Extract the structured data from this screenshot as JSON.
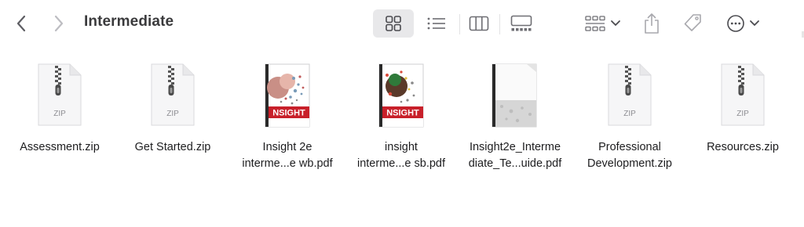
{
  "window": {
    "title": "Intermediate"
  },
  "toolbar": {
    "back": "back-chevron",
    "forward": "forward-chevron",
    "view_modes": [
      "icon-view",
      "list-view",
      "column-view",
      "gallery-view"
    ],
    "active_view": "icon-view",
    "group": "group-by-menu",
    "share": "share-icon",
    "tag": "tag-icon",
    "more": "more-actions-menu"
  },
  "files": [
    {
      "line1": "Assessment.zip",
      "line2": "",
      "type": "zip",
      "badge": "ZIP"
    },
    {
      "line1": "Get Started.zip",
      "line2": "",
      "type": "zip",
      "badge": "ZIP"
    },
    {
      "line1": "Insight 2e",
      "line2": "interme...e wb.pdf",
      "type": "pdf-cover-wb",
      "cover_text": "NSIGHT"
    },
    {
      "line1": "insight",
      "line2": "interme...e sb.pdf",
      "type": "pdf-cover-sb",
      "cover_text": "NSIGHT"
    },
    {
      "line1": "Insight2e_Interme",
      "line2": "diate_Te...uide.pdf",
      "type": "pdf-doc"
    },
    {
      "line1": "Professional",
      "line2": "Development.zip",
      "type": "zip",
      "badge": "ZIP"
    },
    {
      "line1": "Resources.zip",
      "line2": "",
      "type": "zip",
      "badge": "ZIP"
    }
  ],
  "colors": {
    "accent_red": "#c8202a",
    "toolbar_icon": "#6e6e73",
    "title": "#3a3a3c"
  }
}
